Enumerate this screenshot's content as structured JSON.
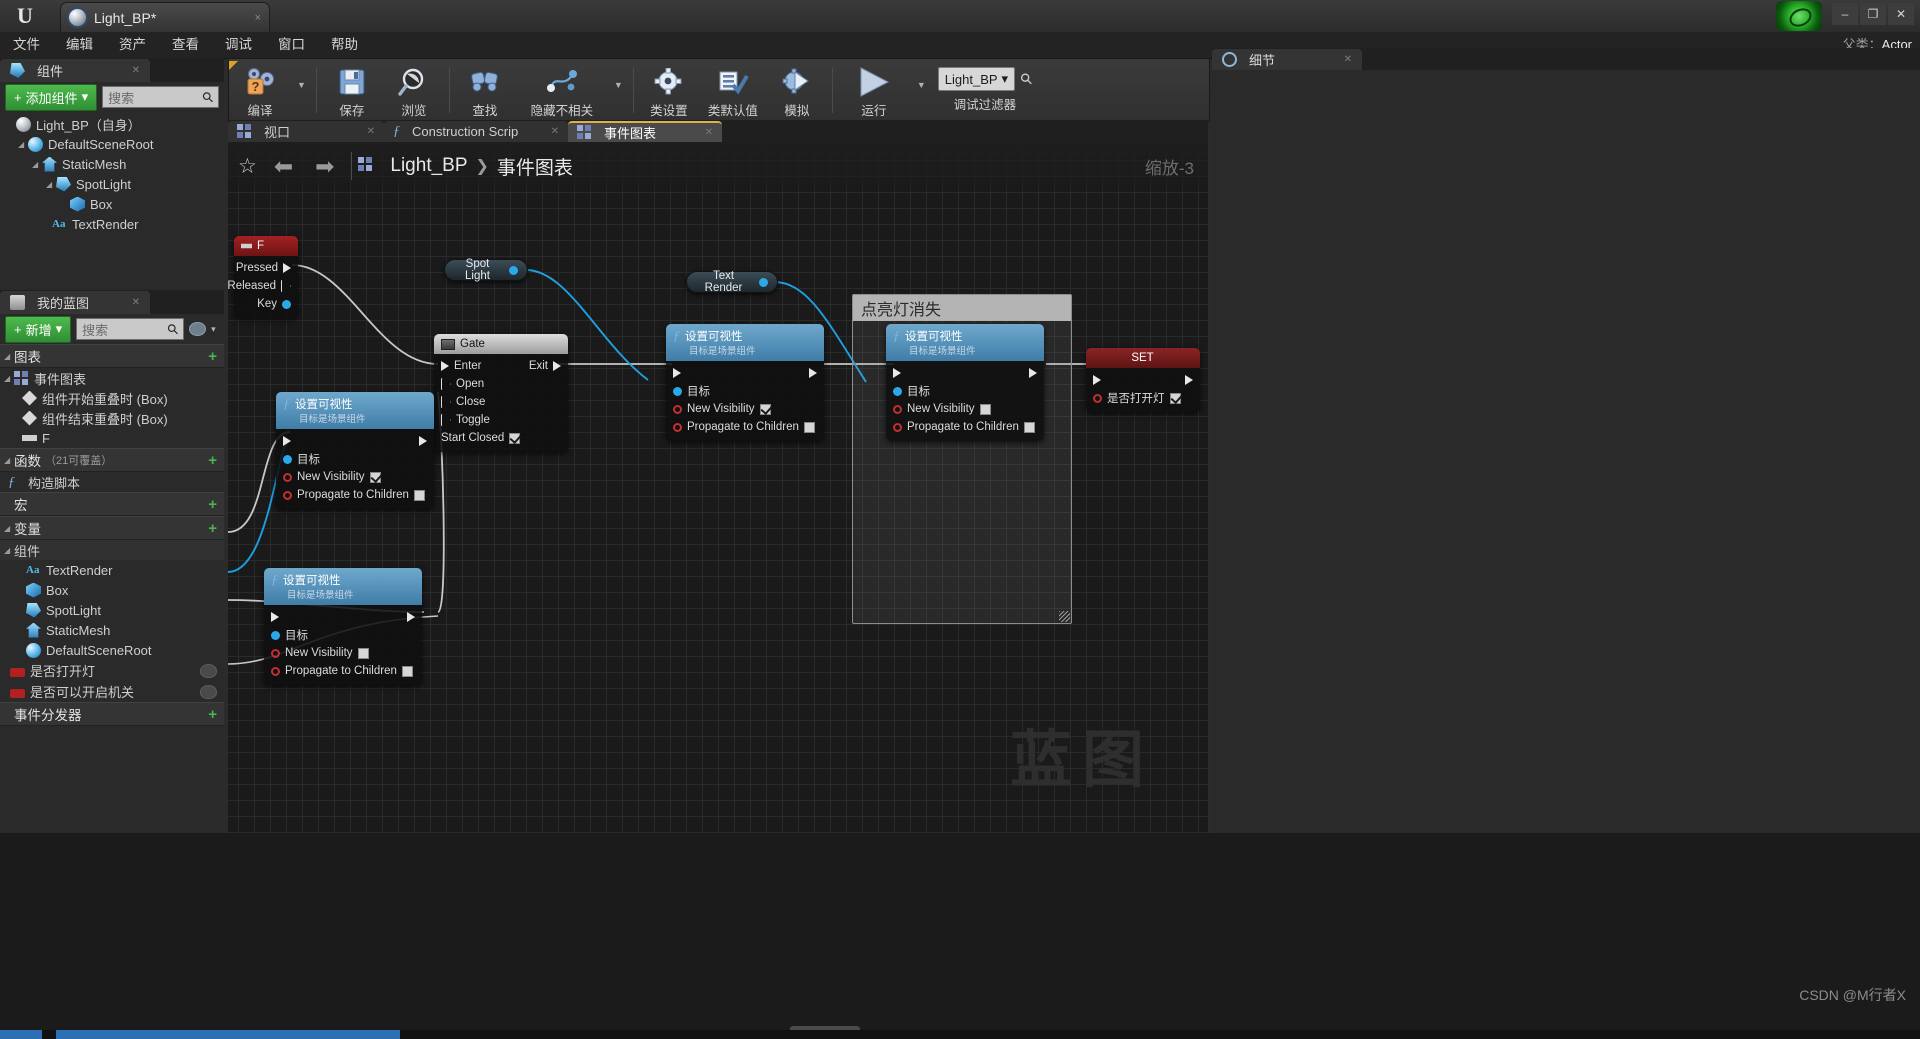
{
  "window": {
    "tab_title": "Light_BP*",
    "tab_close": "×",
    "minimize": "–",
    "maximize": "❐",
    "close": "✕",
    "logo": "U"
  },
  "menu": {
    "items": [
      "文件",
      "编辑",
      "资产",
      "查看",
      "调试",
      "窗口",
      "帮助"
    ],
    "parent_class_label": "父类：",
    "parent_class_value": "Actor"
  },
  "components_panel": {
    "tab_label": "组件",
    "tab_close": "✕",
    "add_button": "添加组件",
    "add_button_plus": "+",
    "add_button_caret": "▾",
    "search_placeholder": "搜索",
    "tree": [
      {
        "label": "Light_BP（自身）",
        "icon": "sphere-icon",
        "depth": 0,
        "arrow": ""
      },
      {
        "label": "DefaultSceneRoot",
        "icon": "scene-root-icon",
        "depth": 1,
        "arrow": "◢"
      },
      {
        "label": "StaticMesh",
        "icon": "static-mesh-icon",
        "depth": 2,
        "arrow": "◢"
      },
      {
        "label": "SpotLight",
        "icon": "spotlight-icon",
        "depth": 3,
        "arrow": "◢"
      },
      {
        "label": "Box",
        "icon": "box-icon",
        "depth": 4,
        "arrow": ""
      },
      {
        "label": "TextRender",
        "icon": "text-render-icon",
        "depth": 3,
        "arrow": ""
      }
    ]
  },
  "myblueprint_panel": {
    "tab_label": "我的蓝图",
    "tab_close": "✕",
    "add_button": "新增",
    "add_button_plus": "+",
    "add_button_caret": "▾",
    "search_placeholder": "搜索",
    "eye_caret": "▾",
    "sections": [
      {
        "title": "图表",
        "count": "",
        "plus": "+",
        "arrow": "◢",
        "rows": [
          {
            "label": "事件图表",
            "icon": "graph-icon",
            "depth": 0,
            "arrow": "◢"
          },
          {
            "label": "组件开始重叠时 (Box)",
            "icon": "event-diamond-icon",
            "depth": 1,
            "arrow": ""
          },
          {
            "label": "组件结束重叠时 (Box)",
            "icon": "event-diamond-icon",
            "depth": 1,
            "arrow": ""
          },
          {
            "label": "F",
            "icon": "key-event-icon",
            "depth": 1,
            "arrow": ""
          }
        ]
      },
      {
        "title": "函数",
        "count": "（21可覆盖）",
        "plus": "+",
        "arrow": "◢",
        "rows": [
          {
            "label": "构造脚本",
            "icon": "construction-script-icon",
            "depth": 1,
            "arrow": ""
          }
        ]
      },
      {
        "title": "宏",
        "count": "",
        "plus": "+",
        "arrow": "",
        "rows": []
      },
      {
        "title": "变量",
        "count": "",
        "plus": "+",
        "arrow": "◢",
        "rows": []
      }
    ],
    "components_group": {
      "title": "组件",
      "arrow": "◢",
      "rows": [
        {
          "label": "TextRender",
          "icon": "text-render-icon"
        },
        {
          "label": "Box",
          "icon": "box-icon"
        },
        {
          "label": "SpotLight",
          "icon": "spotlight-icon"
        },
        {
          "label": "StaticMesh",
          "icon": "static-mesh-icon"
        },
        {
          "label": "DefaultSceneRoot",
          "icon": "scene-root-icon"
        }
      ]
    },
    "variables": [
      {
        "label": "是否打开灯",
        "icon": "bool-variable-icon"
      },
      {
        "label": "是否可以开启机关",
        "icon": "bool-variable-icon"
      }
    ],
    "dispatcher_section": {
      "title": "事件分发器",
      "plus": "+"
    }
  },
  "toolbar": {
    "buttons": [
      {
        "label": "编译",
        "icon": "compile-icon",
        "has_caret": true
      },
      {
        "label": "保存",
        "icon": "save-icon",
        "has_caret": false
      },
      {
        "label": "浏览",
        "icon": "browse-icon",
        "has_caret": false
      },
      {
        "label": "查找",
        "icon": "find-icon",
        "has_caret": false
      },
      {
        "label": "隐藏不相关",
        "icon": "hide-unrelated-icon",
        "has_caret": true
      },
      {
        "label": "类设置",
        "icon": "class-settings-icon",
        "has_caret": false
      },
      {
        "label": "类默认值",
        "icon": "class-defaults-icon",
        "has_caret": false
      },
      {
        "label": "模拟",
        "icon": "simulate-icon",
        "has_caret": false
      },
      {
        "label": "运行",
        "icon": "play-icon",
        "has_caret": true
      }
    ],
    "debug_filter": {
      "value": "Light_BP",
      "caret": "▾",
      "label": "调试过滤器",
      "search_icon": "search-icon"
    }
  },
  "graph_tabs": [
    {
      "label": "视口",
      "icon": "viewport-icon",
      "active": false,
      "close": "✕"
    },
    {
      "label": "Construction Scrip",
      "icon": "function-icon",
      "active": false,
      "close": "✕"
    },
    {
      "label": "事件图表",
      "icon": "graph-icon",
      "active": true,
      "close": "✕"
    }
  ],
  "graph_header": {
    "star": "☆",
    "back": "⬅",
    "forward": "➡",
    "crumb_icon": "graph-icon",
    "crumb_root": "Light_BP",
    "crumb_sep": "❯",
    "crumb_leaf": "事件图表",
    "zoom": "缩放-3",
    "watermark": "蓝图"
  },
  "graph_nodes": {
    "f_key_event": {
      "title": "F",
      "icon": "key-event-icon",
      "pins": [
        {
          "label": "Pressed",
          "type": "exec-out",
          "filled": true
        },
        {
          "label": "Released",
          "type": "exec-out",
          "filled": false
        },
        {
          "label": "Key",
          "type": "data-out",
          "color": "#2aa8e8"
        }
      ]
    },
    "gate": {
      "title": "Gate",
      "icon": "gate-icon",
      "left_pins": [
        "Enter",
        "Open",
        "Close",
        "Toggle"
      ],
      "right_pins": [
        "Exit"
      ],
      "checkbox": {
        "label": "Start Closed",
        "checked": true
      }
    },
    "set_visibility_1": {
      "title": "设置可视性",
      "subtitle": "目标是场景组件",
      "icon": "function-icon",
      "target": "目标",
      "new_visibility": {
        "label": "New Visibility",
        "checked": true
      },
      "propagate": {
        "label": "Propagate to Children",
        "checked": false
      }
    },
    "set_visibility_2": {
      "title": "设置可视性",
      "subtitle": "目标是场景组件",
      "icon": "function-icon",
      "target": "目标",
      "new_visibility": {
        "label": "New Visibility",
        "checked": true
      },
      "propagate": {
        "label": "Propagate to Children",
        "checked": false
      }
    },
    "set_visibility_3": {
      "title": "设置可视性",
      "subtitle": "目标是场景组件",
      "icon": "function-icon",
      "target": "目标",
      "new_visibility": {
        "label": "New Visibility",
        "checked": false
      },
      "propagate": {
        "label": "Propagate to Children",
        "checked": false
      }
    },
    "set_visibility_4": {
      "title": "设置可视性",
      "subtitle": "目标是场景组件",
      "icon": "function-icon",
      "target": "目标",
      "new_visibility": {
        "label": "New Visibility",
        "checked": false
      },
      "propagate": {
        "label": "Propagate to Children",
        "checked": false
      }
    },
    "spot_light_getter": {
      "label": "Spot Light"
    },
    "text_render_getter": {
      "label": "Text Render"
    },
    "set_node": {
      "title": "SET",
      "variable": "是否打开灯",
      "checked": true
    },
    "comment": {
      "title": "点亮灯消失"
    }
  },
  "details_panel": {
    "tab_label": "细节",
    "tab_close": "✕",
    "icon": "search-icon"
  },
  "credit": "CSDN @M行者X",
  "colors": {
    "accent_green": "#3f9f3f",
    "accent_yellow": "#e0b040",
    "exec_wire": "#c8c8c8",
    "data_wire": "#1e9fe0",
    "node_function_header": "#4f8db5",
    "node_event_header": "#8f1f1f"
  }
}
